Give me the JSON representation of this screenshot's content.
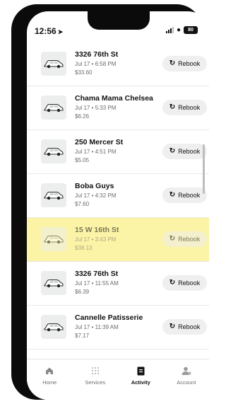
{
  "status_bar": {
    "time": "12:56",
    "location_arrow": "➤",
    "battery": "80"
  },
  "rebook_icon": "↻",
  "rides": [
    {
      "title": "3326 76th St",
      "date": "Jul 17 • 6:58 PM",
      "price": "$33.60",
      "button": "Rebook",
      "highlighted": false
    },
    {
      "title": "Chama Mama Chelsea",
      "date": "Jul 17 • 5:33 PM",
      "price": "$6.26",
      "button": "Rebook",
      "highlighted": false
    },
    {
      "title": "250 Mercer St",
      "date": "Jul 17 • 4:51 PM",
      "price": "$5.05",
      "button": "Rebook",
      "highlighted": false
    },
    {
      "title": "Boba Guys",
      "date": "Jul 17 • 4:32 PM",
      "price": "$7.60",
      "button": "Rebook",
      "highlighted": false
    },
    {
      "title": "15 W 16th St",
      "date": "Jul 17 • 3:43 PM",
      "price": "$38.13",
      "button": "Rebook",
      "highlighted": true
    },
    {
      "title": "3326 76th St",
      "date": "Jul 17 • 11:55 AM",
      "price": "$6.39",
      "button": "Rebook",
      "highlighted": false
    },
    {
      "title": "Cannelle Patisserie",
      "date": "Jul 17 • 11:39 AM",
      "price": "$7.17",
      "button": "Rebook",
      "highlighted": false
    }
  ],
  "tabs": [
    {
      "label": "Home",
      "icon": "home-icon",
      "active": false
    },
    {
      "label": "Services",
      "icon": "grid-icon",
      "active": false
    },
    {
      "label": "Activity",
      "icon": "receipt-icon",
      "active": true
    },
    {
      "label": "Account",
      "icon": "person-icon",
      "active": false
    }
  ]
}
